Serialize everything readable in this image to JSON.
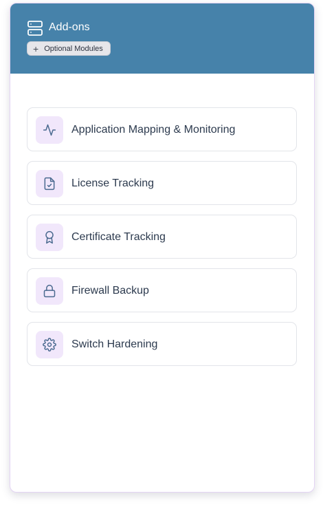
{
  "header": {
    "title": "Add-ons",
    "icon": "server-icon",
    "chip": {
      "icon": "plus-icon",
      "label": "Optional Modules"
    },
    "background": "#4682aa"
  },
  "items": [
    {
      "label": "Application Mapping & Monitoring",
      "icon": "activity-icon"
    },
    {
      "label": "License Tracking",
      "icon": "file-check-icon"
    },
    {
      "label": "Certificate Tracking",
      "icon": "award-icon"
    },
    {
      "label": "Firewall Backup",
      "icon": "lock-icon"
    },
    {
      "label": "Switch Hardening",
      "icon": "gear-icon"
    }
  ],
  "colors": {
    "accent": "#4682aa",
    "icon_bg": "#f1e7fb",
    "text": "#2c3a4e"
  }
}
